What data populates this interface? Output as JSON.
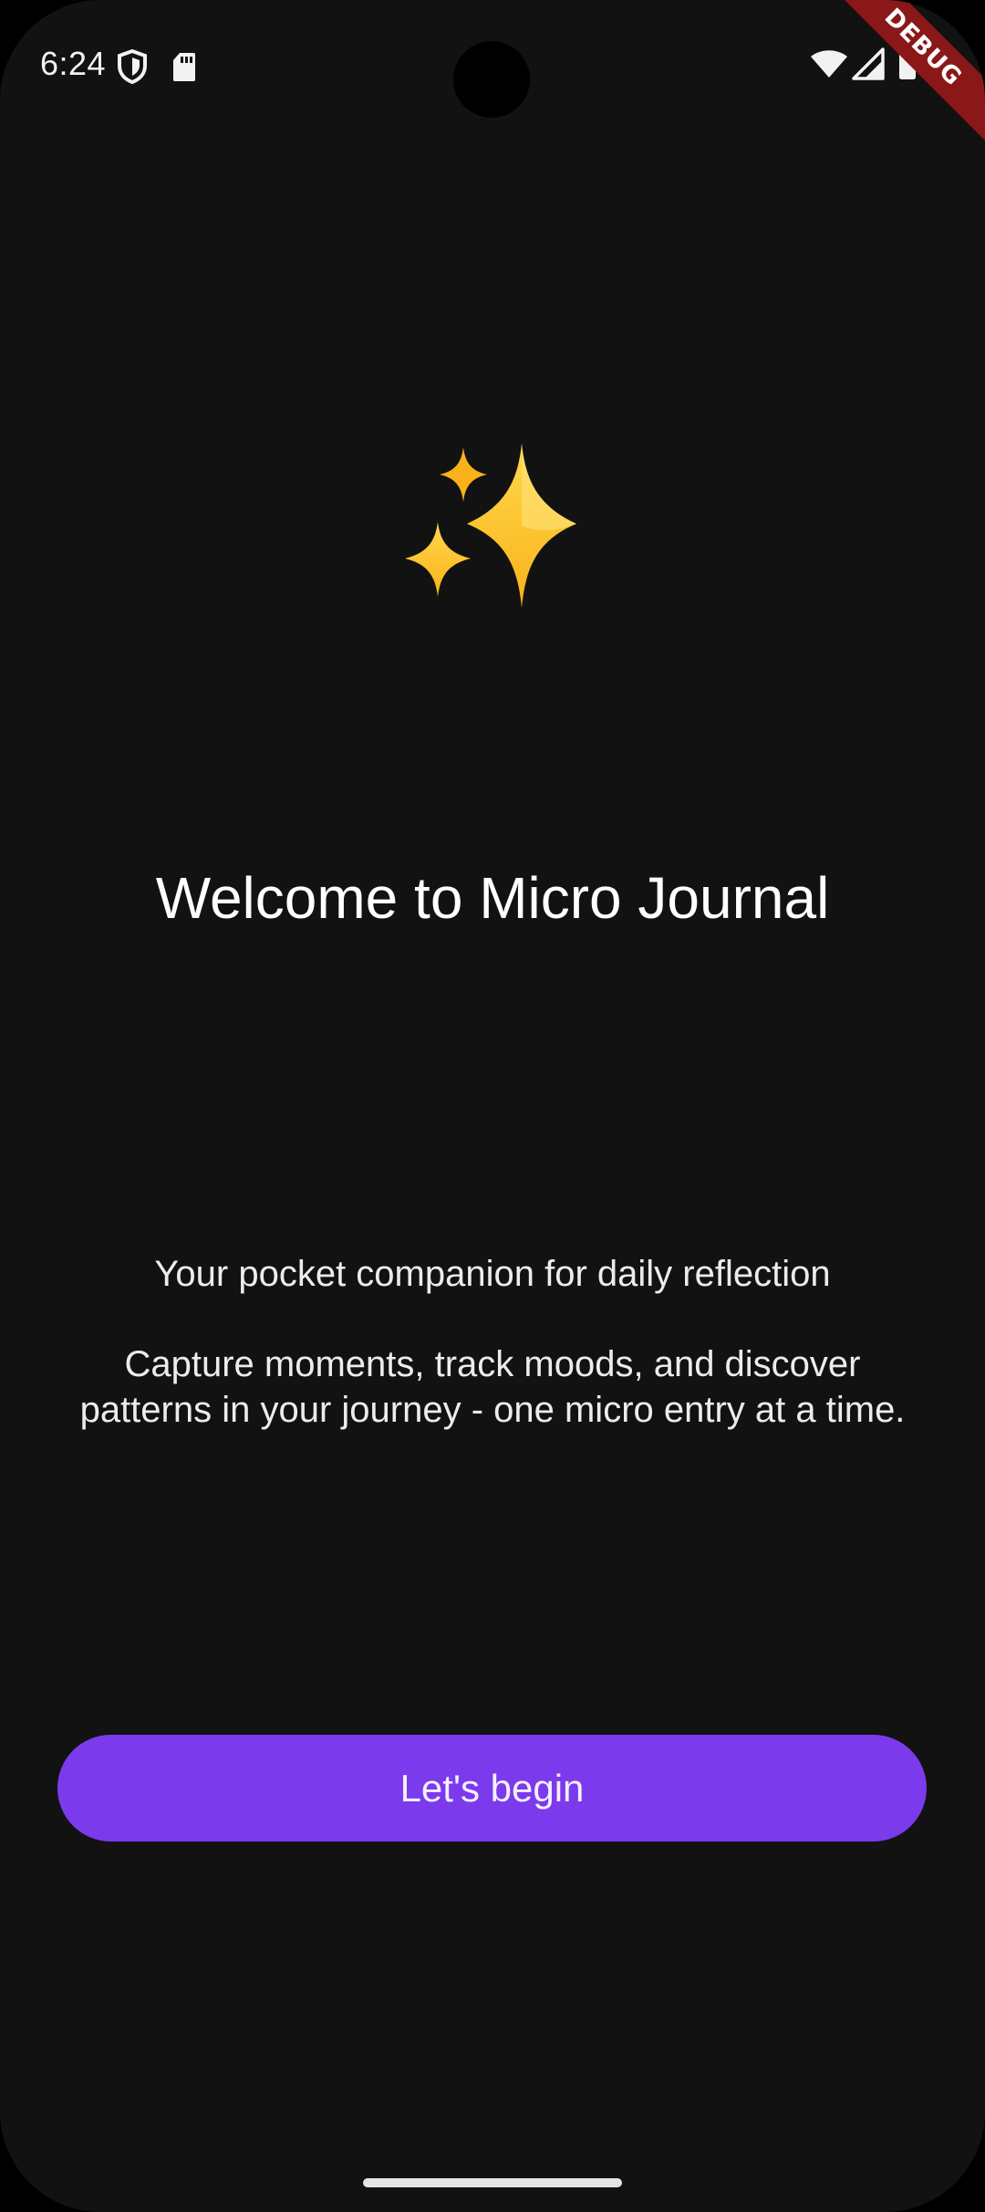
{
  "status_bar": {
    "time": "6:24",
    "icons": [
      "shield-icon",
      "sd-card-icon",
      "wifi-icon",
      "cell-signal-icon",
      "battery-icon"
    ]
  },
  "debug_banner": {
    "label": "DEBUG",
    "color": "#8a1818"
  },
  "welcome": {
    "emoji_icon": "sparkles-icon",
    "title": "Welcome to Micro Journal",
    "tagline": "Your pocket companion for daily reflection",
    "description": "Capture moments, track moods, and discover patterns in your journey - one micro entry at a time."
  },
  "actions": {
    "begin_label": "Let's begin"
  },
  "colors": {
    "background": "#121212",
    "accent": "#7c3aed",
    "sparkle_gold": "#fcc21b"
  }
}
